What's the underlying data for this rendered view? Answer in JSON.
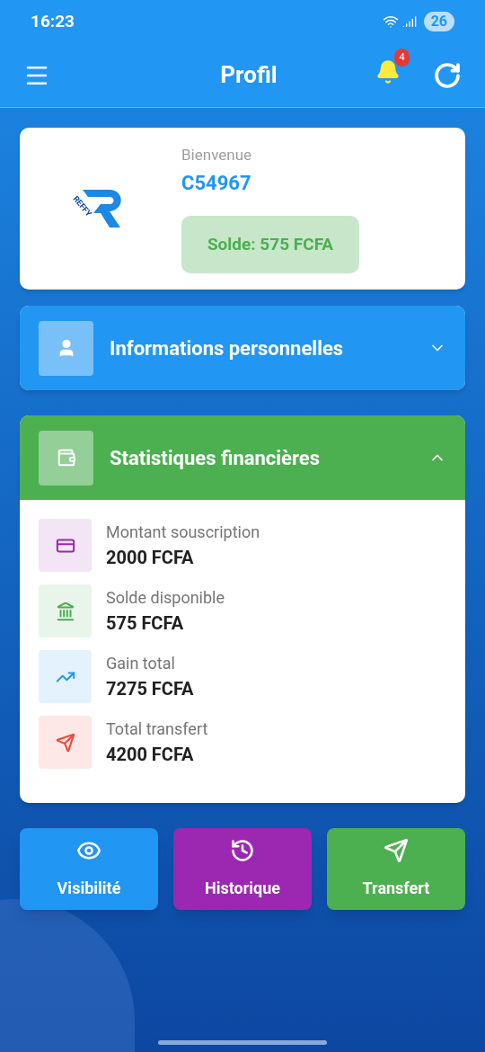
{
  "status_bar": {
    "time": "16:23",
    "battery": "26"
  },
  "header": {
    "title": "Profil",
    "notification_count": "4"
  },
  "profile": {
    "logo_text": "REFFY",
    "greeting": "Bienvenue",
    "user_id": "C54967",
    "balance": "Solde: 575 FCFA"
  },
  "sections": [
    {
      "title": "Informations personnelles",
      "kind": "person",
      "color": "#2196f3",
      "expanded": false
    },
    {
      "title": "Statistiques financières",
      "kind": "wallet",
      "color": "#4caf50",
      "expanded": true,
      "items": [
        {
          "kind": "card",
          "color": "#9c27b0",
          "label": "Montant souscription",
          "value": "2000 FCFA"
        },
        {
          "kind": "bank",
          "color": "#4caf50",
          "label": "Solde disponible",
          "value": "575 FCFA"
        },
        {
          "kind": "trend",
          "color": "#2196f3",
          "label": "Gain total",
          "value": "7275 FCFA"
        },
        {
          "kind": "send",
          "color": "#f44336",
          "label": "Total transfert",
          "value": "4200 FCFA"
        }
      ]
    }
  ],
  "actions": [
    {
      "kind": "eye",
      "label": "Visibilité",
      "color": "#2196f3"
    },
    {
      "kind": "history",
      "label": "Historique",
      "color": "#9c27b0"
    },
    {
      "kind": "send",
      "label": "Transfert",
      "color": "#4caf50"
    }
  ]
}
